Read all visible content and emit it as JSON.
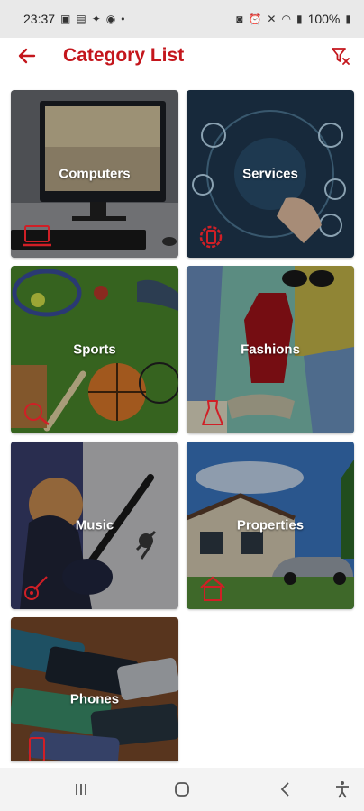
{
  "status_bar": {
    "time": "23:37",
    "battery": "100%"
  },
  "header": {
    "title": "Category List",
    "back_icon": "arrow-left-icon",
    "filter_icon": "filter-clear-icon"
  },
  "colors": {
    "accent": "#c4161c",
    "status_bar_bg": "#e9e9e9",
    "nav_bar_bg": "#f3f3f3"
  },
  "categories": [
    {
      "label": "Computers",
      "icon": "laptop-icon"
    },
    {
      "label": "Services",
      "icon": "gear-phone-icon"
    },
    {
      "label": "Sports",
      "icon": "sports-icon"
    },
    {
      "label": "Fashions",
      "icon": "dress-icon"
    },
    {
      "label": "Music",
      "icon": "guitar-icon"
    },
    {
      "label": "Properties",
      "icon": "house-icon"
    },
    {
      "label": "Phones",
      "icon": "phone-icon"
    }
  ],
  "nav_bar": {
    "items": [
      "recents-icon",
      "home-icon",
      "back-icon",
      "accessibility-icon"
    ]
  }
}
